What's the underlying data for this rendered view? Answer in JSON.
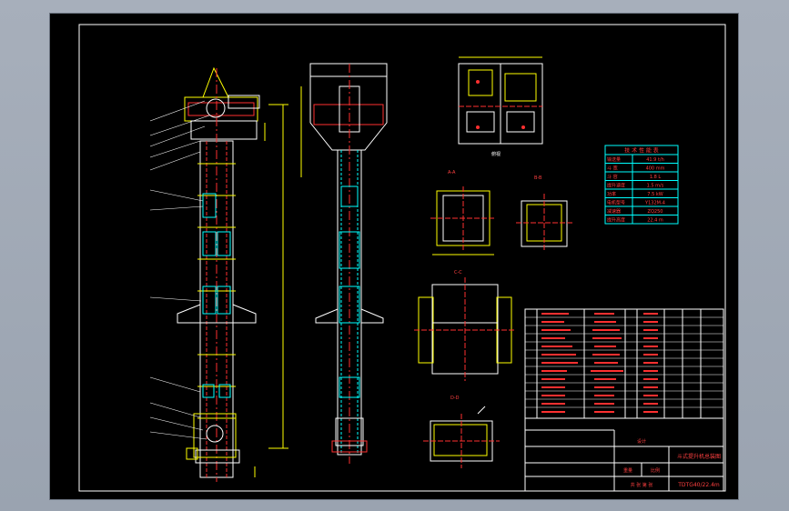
{
  "sheet": {
    "title_block": {
      "drawing_title": "斗式提升机总装图",
      "drawing_number": "TDTG40/22.4m",
      "company": "设计",
      "label_weight": "重量",
      "label_scale": "比例",
      "label_sheet": "共 张 第 张"
    },
    "spec_table": {
      "heading": "技 术 性 能 表",
      "rows": [
        {
          "k": "输送量",
          "v": "41.9 t/h"
        },
        {
          "k": "斗 宽",
          "v": "400 mm"
        },
        {
          "k": "斗 容",
          "v": "1.8 L"
        },
        {
          "k": "提升速度",
          "v": "1.5 m/s"
        },
        {
          "k": "功率",
          "v": "7.5 kW"
        },
        {
          "k": "电机型号",
          "v": "Y132M-4"
        },
        {
          "k": "减速器",
          "v": "ZQ250"
        },
        {
          "k": "提升高度",
          "v": "22.4 m"
        }
      ]
    },
    "views": {
      "view_a": "A-A",
      "view_b": "B-B",
      "view_c": "C-C",
      "view_d": "D-D",
      "view_top": "俯视"
    },
    "colors": {
      "line_yellow": "#ffff00",
      "line_white": "#ffffff",
      "line_red": "#ff3030",
      "line_cyan": "#00ffff",
      "line_green": "#00ff00"
    }
  }
}
